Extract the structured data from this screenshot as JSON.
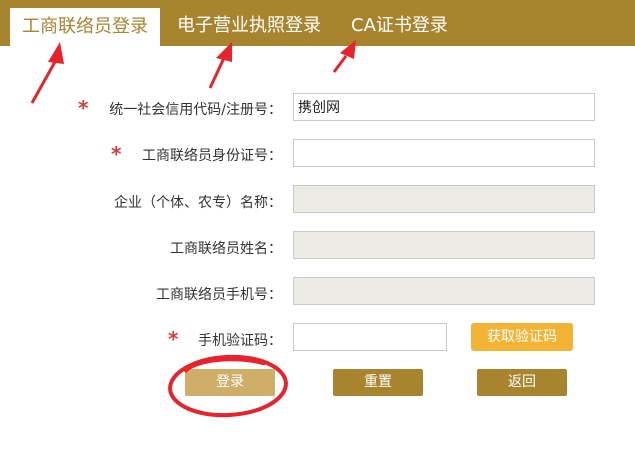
{
  "tabs": [
    {
      "label": "工商联络员登录",
      "active": true
    },
    {
      "label": "电子营业执照登录",
      "active": false
    },
    {
      "label": "CA证书登录",
      "active": false
    }
  ],
  "form": {
    "credit_code": {
      "label": "统一社会信用代码/注册号：",
      "value": "携创网",
      "required": true
    },
    "id_number": {
      "label": "工商联络员身份证号：",
      "value": "",
      "required": true
    },
    "company_name": {
      "label": "企业（个体、农专）名称：",
      "value": ""
    },
    "liaison_name": {
      "label": "工商联络员姓名：",
      "value": ""
    },
    "liaison_phone": {
      "label": "工商联络员手机号：",
      "value": ""
    },
    "sms_code": {
      "label": "手机验证码：",
      "value": "",
      "required": true
    }
  },
  "buttons": {
    "get_code": "获取验证码",
    "login": "登录",
    "reset": "重置",
    "back": "返回"
  },
  "colors": {
    "brand": "#a9842f",
    "required_star": "#e23a3a",
    "code_button": "#f3b436",
    "annotation": "#e8232b"
  },
  "star": "*"
}
